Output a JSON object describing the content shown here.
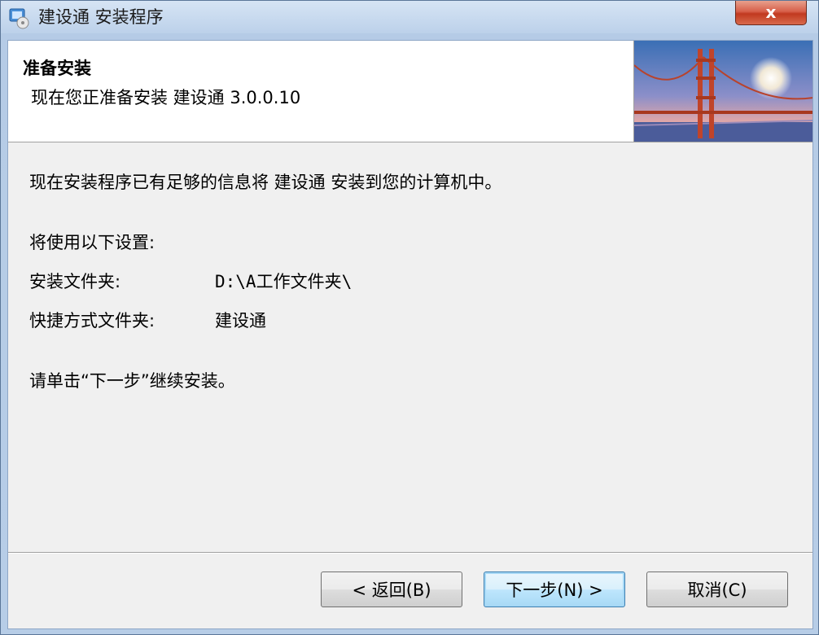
{
  "window": {
    "title": "建设通 安装程序",
    "close_label": "x"
  },
  "header": {
    "title": "准备安装",
    "subtitle": "现在您正准备安装 建设通 3.0.0.10"
  },
  "content": {
    "intro": "现在安装程序已有足够的信息将 建设通 安装到您的计算机中。",
    "settings_heading": "将使用以下设置:",
    "install_folder_label": "安装文件夹:",
    "install_folder_value": "D:\\A工作文件夹\\",
    "shortcut_folder_label": "快捷方式文件夹:",
    "shortcut_folder_value": "建设通",
    "instruction": "请单击“下一步”继续安装。"
  },
  "buttons": {
    "back": "< 返回(B)",
    "next": "下一步(N) >",
    "cancel": "取消(C)"
  },
  "colors": {
    "accent": "#3c7fb1",
    "close": "#c1391f"
  }
}
